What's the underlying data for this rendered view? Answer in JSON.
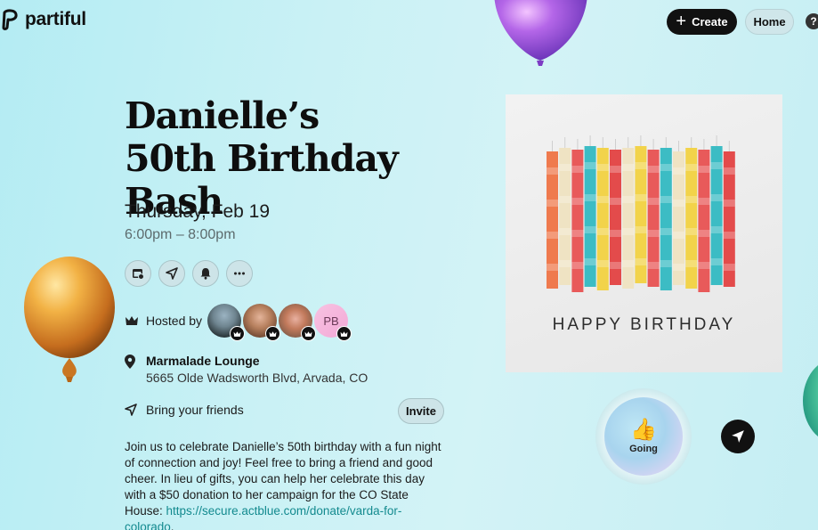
{
  "header": {
    "logo_text": "partiful",
    "create_label": "Create",
    "home_label": "Home",
    "help_label": "?"
  },
  "event": {
    "title": "Danielle’s 50th Birthday Bash",
    "date": "Thursday, Feb 19",
    "time": "6:00pm – 8:00pm",
    "hosted_by_label": "Hosted by",
    "hosts": [
      {
        "initials": ""
      },
      {
        "initials": ""
      },
      {
        "initials": ""
      },
      {
        "initials": "PB"
      }
    ],
    "location_name": "Marmalade Lounge",
    "location_address": "5665 Olde Wadsworth Blvd, Arvada, CO",
    "bring_friends_label": "Bring your friends",
    "invite_label": "Invite",
    "description": "Join us to celebrate Danielle’s 50th birthday with a fun night of connection and joy! Feel free to bring a friend and good cheer. In lieu of gifts, you can help her celebrate this day with a $50 donation to her campaign for the CO State House: ",
    "link_text": "https://secure.actblue.com/donate/varda-for-colorado",
    "link_suffix": "."
  },
  "card": {
    "caption": "HAPPY BIRTHDAY"
  },
  "rsvp": {
    "status_label": "Going",
    "icon": "thumbs-up-icon"
  },
  "icons": {
    "row": [
      "calendar-add-icon",
      "send-icon",
      "bell-icon",
      "more-icon"
    ],
    "host": "crown-icon",
    "location": "map-pin-icon",
    "bring": "send-icon",
    "share": "send-icon"
  },
  "colors": {
    "accent_dark": "#111111",
    "link": "#138a8f",
    "background": "#c9f1f5"
  }
}
